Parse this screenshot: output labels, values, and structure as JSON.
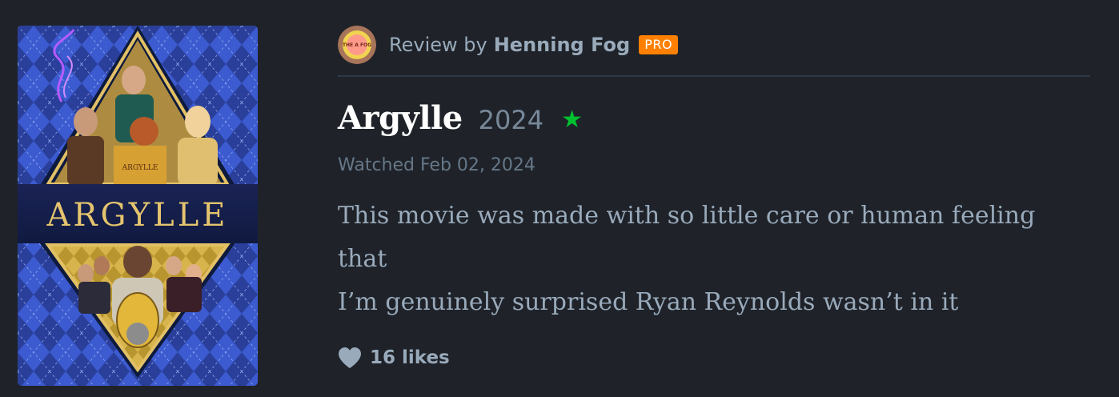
{
  "poster": {
    "title_text": "ARGYLLE",
    "book_text": "ARGYLLE"
  },
  "review": {
    "byline_prefix": "Review by",
    "author": "Henning Fog",
    "badge": "PRO",
    "avatar_text": "THE A FOG"
  },
  "film": {
    "title": "Argylle",
    "year": "2024",
    "rating_stars": 1,
    "rating_icon": "star-icon"
  },
  "watched": "Watched Feb 02, 2024",
  "body_lines": [
    "This movie was made with so little care or human feeling that",
    "I’m genuinely surprised Ryan Reynolds wasn’t in it"
  ],
  "likes": {
    "label": "16 likes",
    "icon": "heart-icon"
  },
  "colors": {
    "background": "#1f2329",
    "badge": "#ff8000",
    "star": "#00c030",
    "muted_text": "#99aabb"
  }
}
